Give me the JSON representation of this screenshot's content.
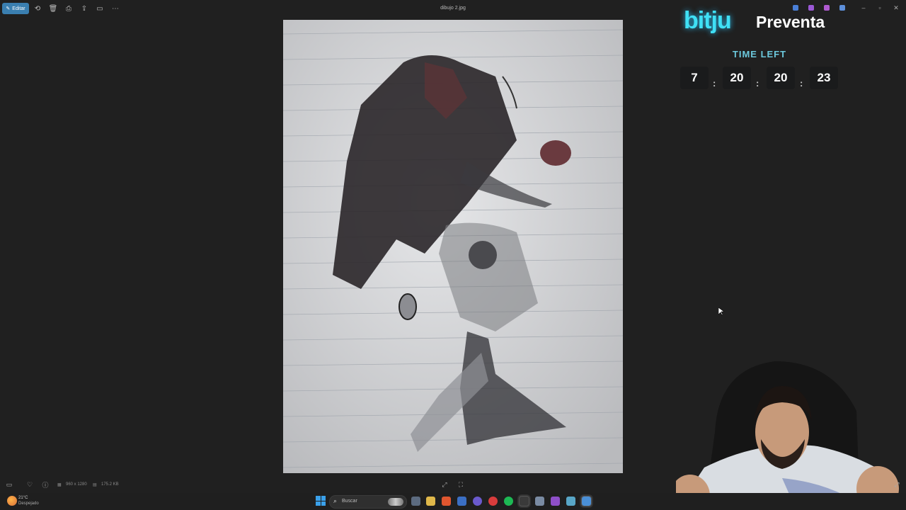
{
  "toolbar": {
    "edit_label": "Editar",
    "filename": "dibujo 2.jpg"
  },
  "overlay": {
    "brand_logo": "bitju",
    "brand_word": "Preventa",
    "time_left_label": "TIME LEFT",
    "countdown": [
      "7",
      "20",
      "20",
      "23"
    ],
    "separator": ":"
  },
  "statusbar": {
    "dimensions": "960 x 1280",
    "filesize": "175.2 KB"
  },
  "taskbar": {
    "temperature": "21°C",
    "weather": "Despejado",
    "search_placeholder": "Buscar"
  },
  "icons": [
    "edit-icon",
    "rotate-icon",
    "delete-icon",
    "print-icon",
    "share-icon",
    "slideshow-icon",
    "more-icon",
    "favorite-icon",
    "info-icon",
    "fit-icon",
    "fullscreen-icon",
    "windows-start-icon",
    "search-icon"
  ],
  "colors": {
    "accent": "#3a7fb0",
    "brand_cyan": "#3fe0f5",
    "background": "#202020"
  }
}
